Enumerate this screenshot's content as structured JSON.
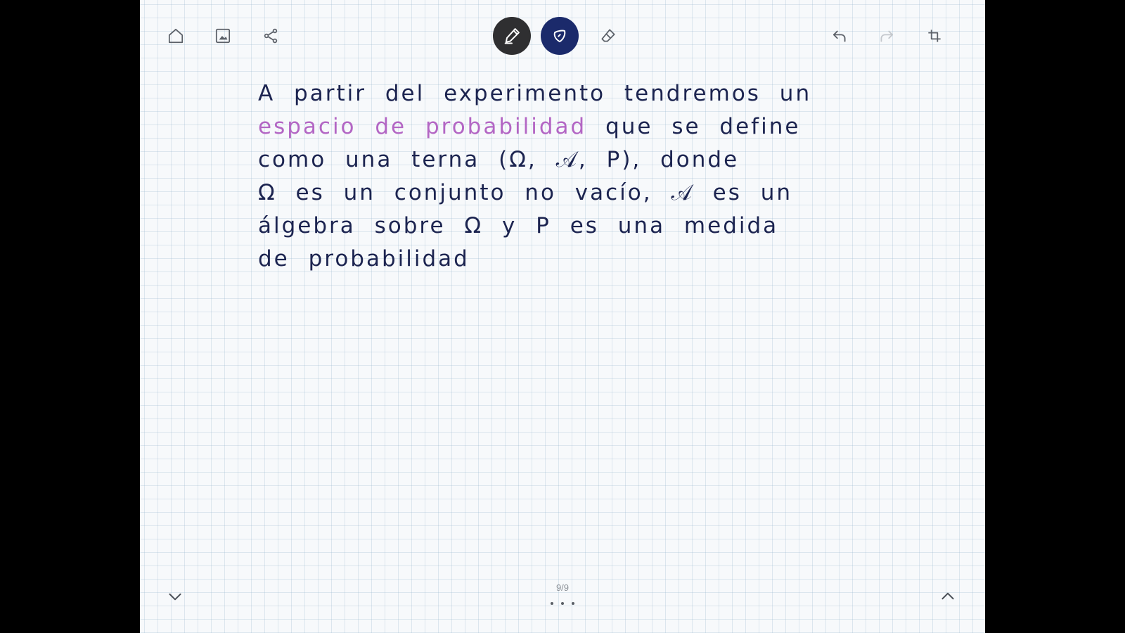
{
  "toolbar": {
    "left": [
      "home-icon",
      "image-icon",
      "share-icon"
    ],
    "center": [
      "pen-icon",
      "highlighter-icon",
      "eraser-icon"
    ],
    "right": [
      "undo-icon",
      "redo-icon",
      "crop-icon"
    ],
    "pen_color": "#2f2f31",
    "highlighter_color": "#1b2a6b"
  },
  "note": {
    "line1": "A partir del experimento tendremos un",
    "highlight": "espacio de probabilidad",
    "line2_rest": " que se define",
    "line3": "como una terna (Ω, 𝒜, P), donde",
    "line4": "Ω es un conjunto no vacío, 𝒜 es un",
    "line5": "álgebra sobre Ω y P es una medida",
    "line6": "de probabilidad",
    "ink_color": "#1c2450",
    "highlight_color": "#b366c4"
  },
  "footer": {
    "page_indicator": "9/9",
    "prev_icon": "chevron-down-icon",
    "next_icon": "chevron-up-icon",
    "more_icon": "more-dots-icon"
  }
}
